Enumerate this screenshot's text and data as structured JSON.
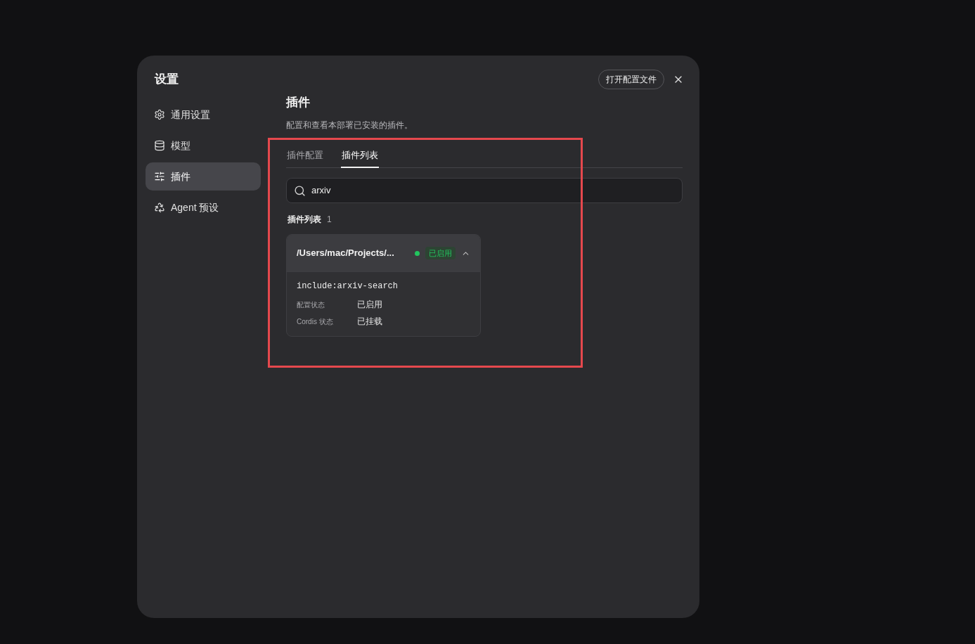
{
  "dialog": {
    "title": "设置",
    "open_config_button": "打开配置文件"
  },
  "sidebar": {
    "items": [
      {
        "label": "通用设置",
        "selected": false
      },
      {
        "label": "模型",
        "selected": false
      },
      {
        "label": "插件",
        "selected": true
      },
      {
        "label": "Agent 预设",
        "selected": false
      }
    ]
  },
  "content": {
    "title": "插件",
    "description": "配置和查看本部署已安装的插件。",
    "tabs": [
      {
        "label": "插件配置",
        "selected": false
      },
      {
        "label": "插件列表",
        "selected": true
      }
    ],
    "search": {
      "value": "arxiv"
    },
    "list_title": "插件列表",
    "list_count": "1",
    "plugins": [
      {
        "name": "/Users/mac/Projects/...",
        "status": "已启用",
        "color": "#22c55e",
        "expanded": true,
        "identifier": "include:arxiv-search",
        "details": [
          {
            "label": "配置状态",
            "value": "已启用"
          },
          {
            "label": "Cordis 状态",
            "value": "已挂载"
          }
        ]
      }
    ]
  }
}
